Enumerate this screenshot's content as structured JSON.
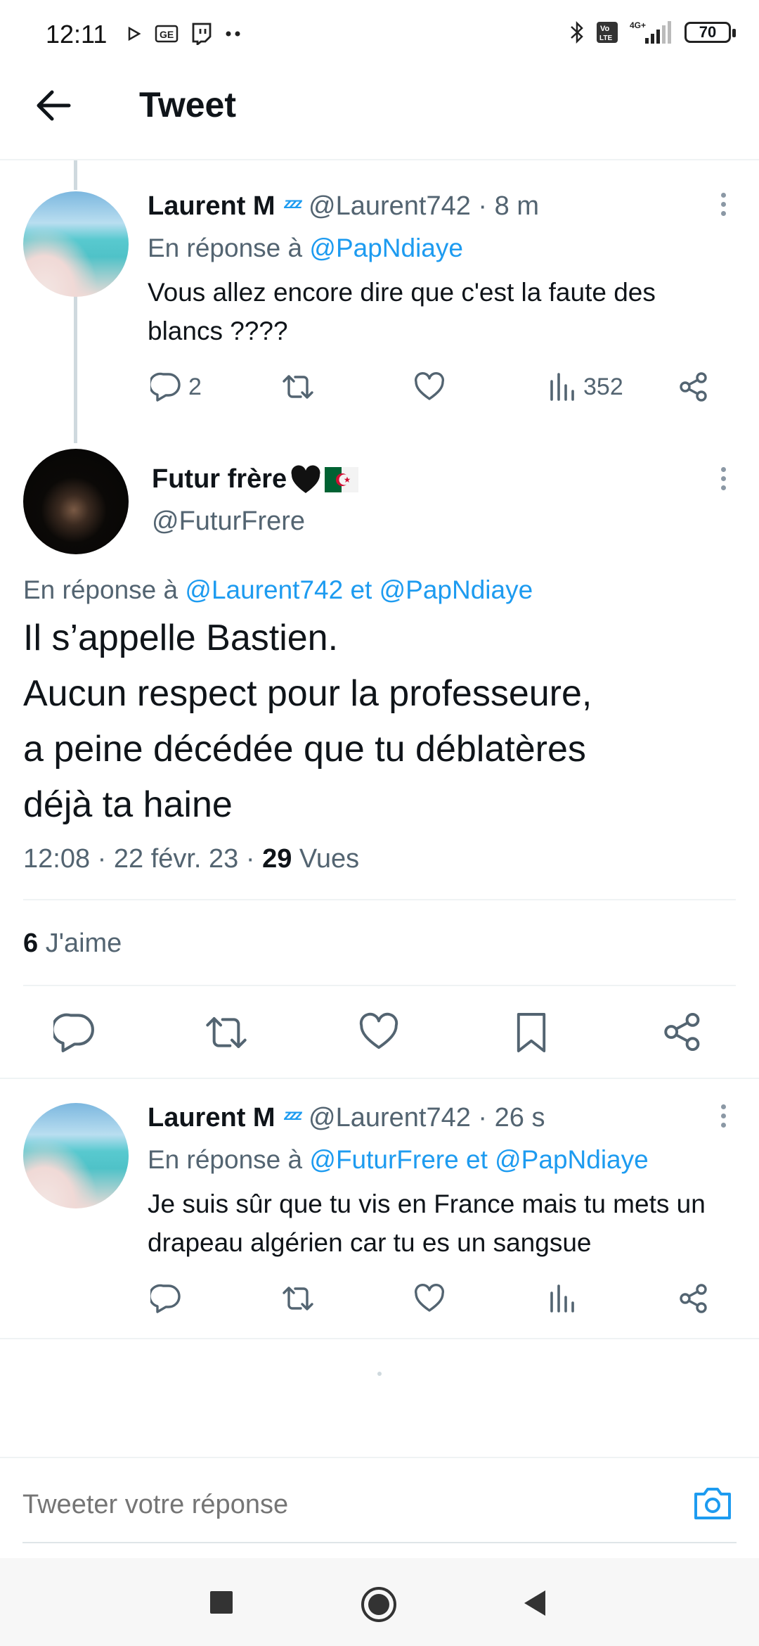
{
  "status_bar": {
    "time": "12:11",
    "network": "4G+",
    "volte": "Vo LTE",
    "battery": "70"
  },
  "header": {
    "title": "Tweet"
  },
  "tweets": [
    {
      "name": "Laurent M",
      "handle_time": "@Laurent742 · 8 m",
      "reply_prefix": "En réponse à ",
      "reply_handles": "@PapNdiaye",
      "text": "Vous allez encore dire que c'est la faute des blancs ????",
      "replies": "2",
      "views": "352"
    },
    {
      "name": "Futur frère",
      "handle": "@FuturFrere",
      "reply_prefix": "En réponse à ",
      "reply_handles": "@Laurent742 et @PapNdiaye",
      "text_lines": [
        "Il s’appelle Bastien.",
        "Aucun respect pour la professeure,",
        "a peine décédée que tu déblatères",
        "déjà ta haine"
      ],
      "time": "12:08 · 22 févr. 23 · ",
      "views_count": "29",
      "views_label": " Vues",
      "likes_count": "6",
      "likes_label": " J'aime"
    },
    {
      "name": "Laurent M",
      "handle_time": "@Laurent742 · 26 s",
      "reply_prefix": "En réponse à ",
      "reply_handles": "@FuturFrere et @PapNdiaye",
      "text": "Je suis sûr que tu vis en France mais tu mets un drapeau algérien car tu es un sangsue"
    }
  ],
  "reply_box": {
    "placeholder": "Tweeter votre réponse"
  },
  "colors": {
    "accent": "#1d9bf0",
    "secondary_text": "#536471",
    "divider": "#eff3f4"
  }
}
